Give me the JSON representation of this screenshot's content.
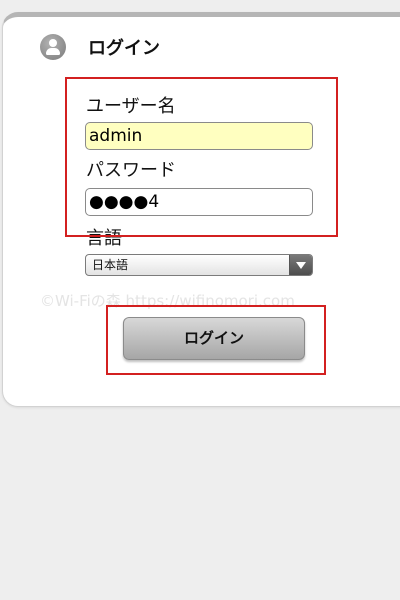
{
  "header": {
    "title": "ログイン",
    "icon": "user-icon"
  },
  "form": {
    "username_label": "ユーザー名",
    "username_value": "admin",
    "password_label": "パスワード",
    "password_value": "●●●●4",
    "language_label": "言語",
    "language_selected": "日本語"
  },
  "login_button_label": "ログイン",
  "watermark": "©Wi-Fiの森 https://wifinomori.com",
  "colors": {
    "highlight_box": "#d32020",
    "autofill_background": "#ffffc0"
  }
}
